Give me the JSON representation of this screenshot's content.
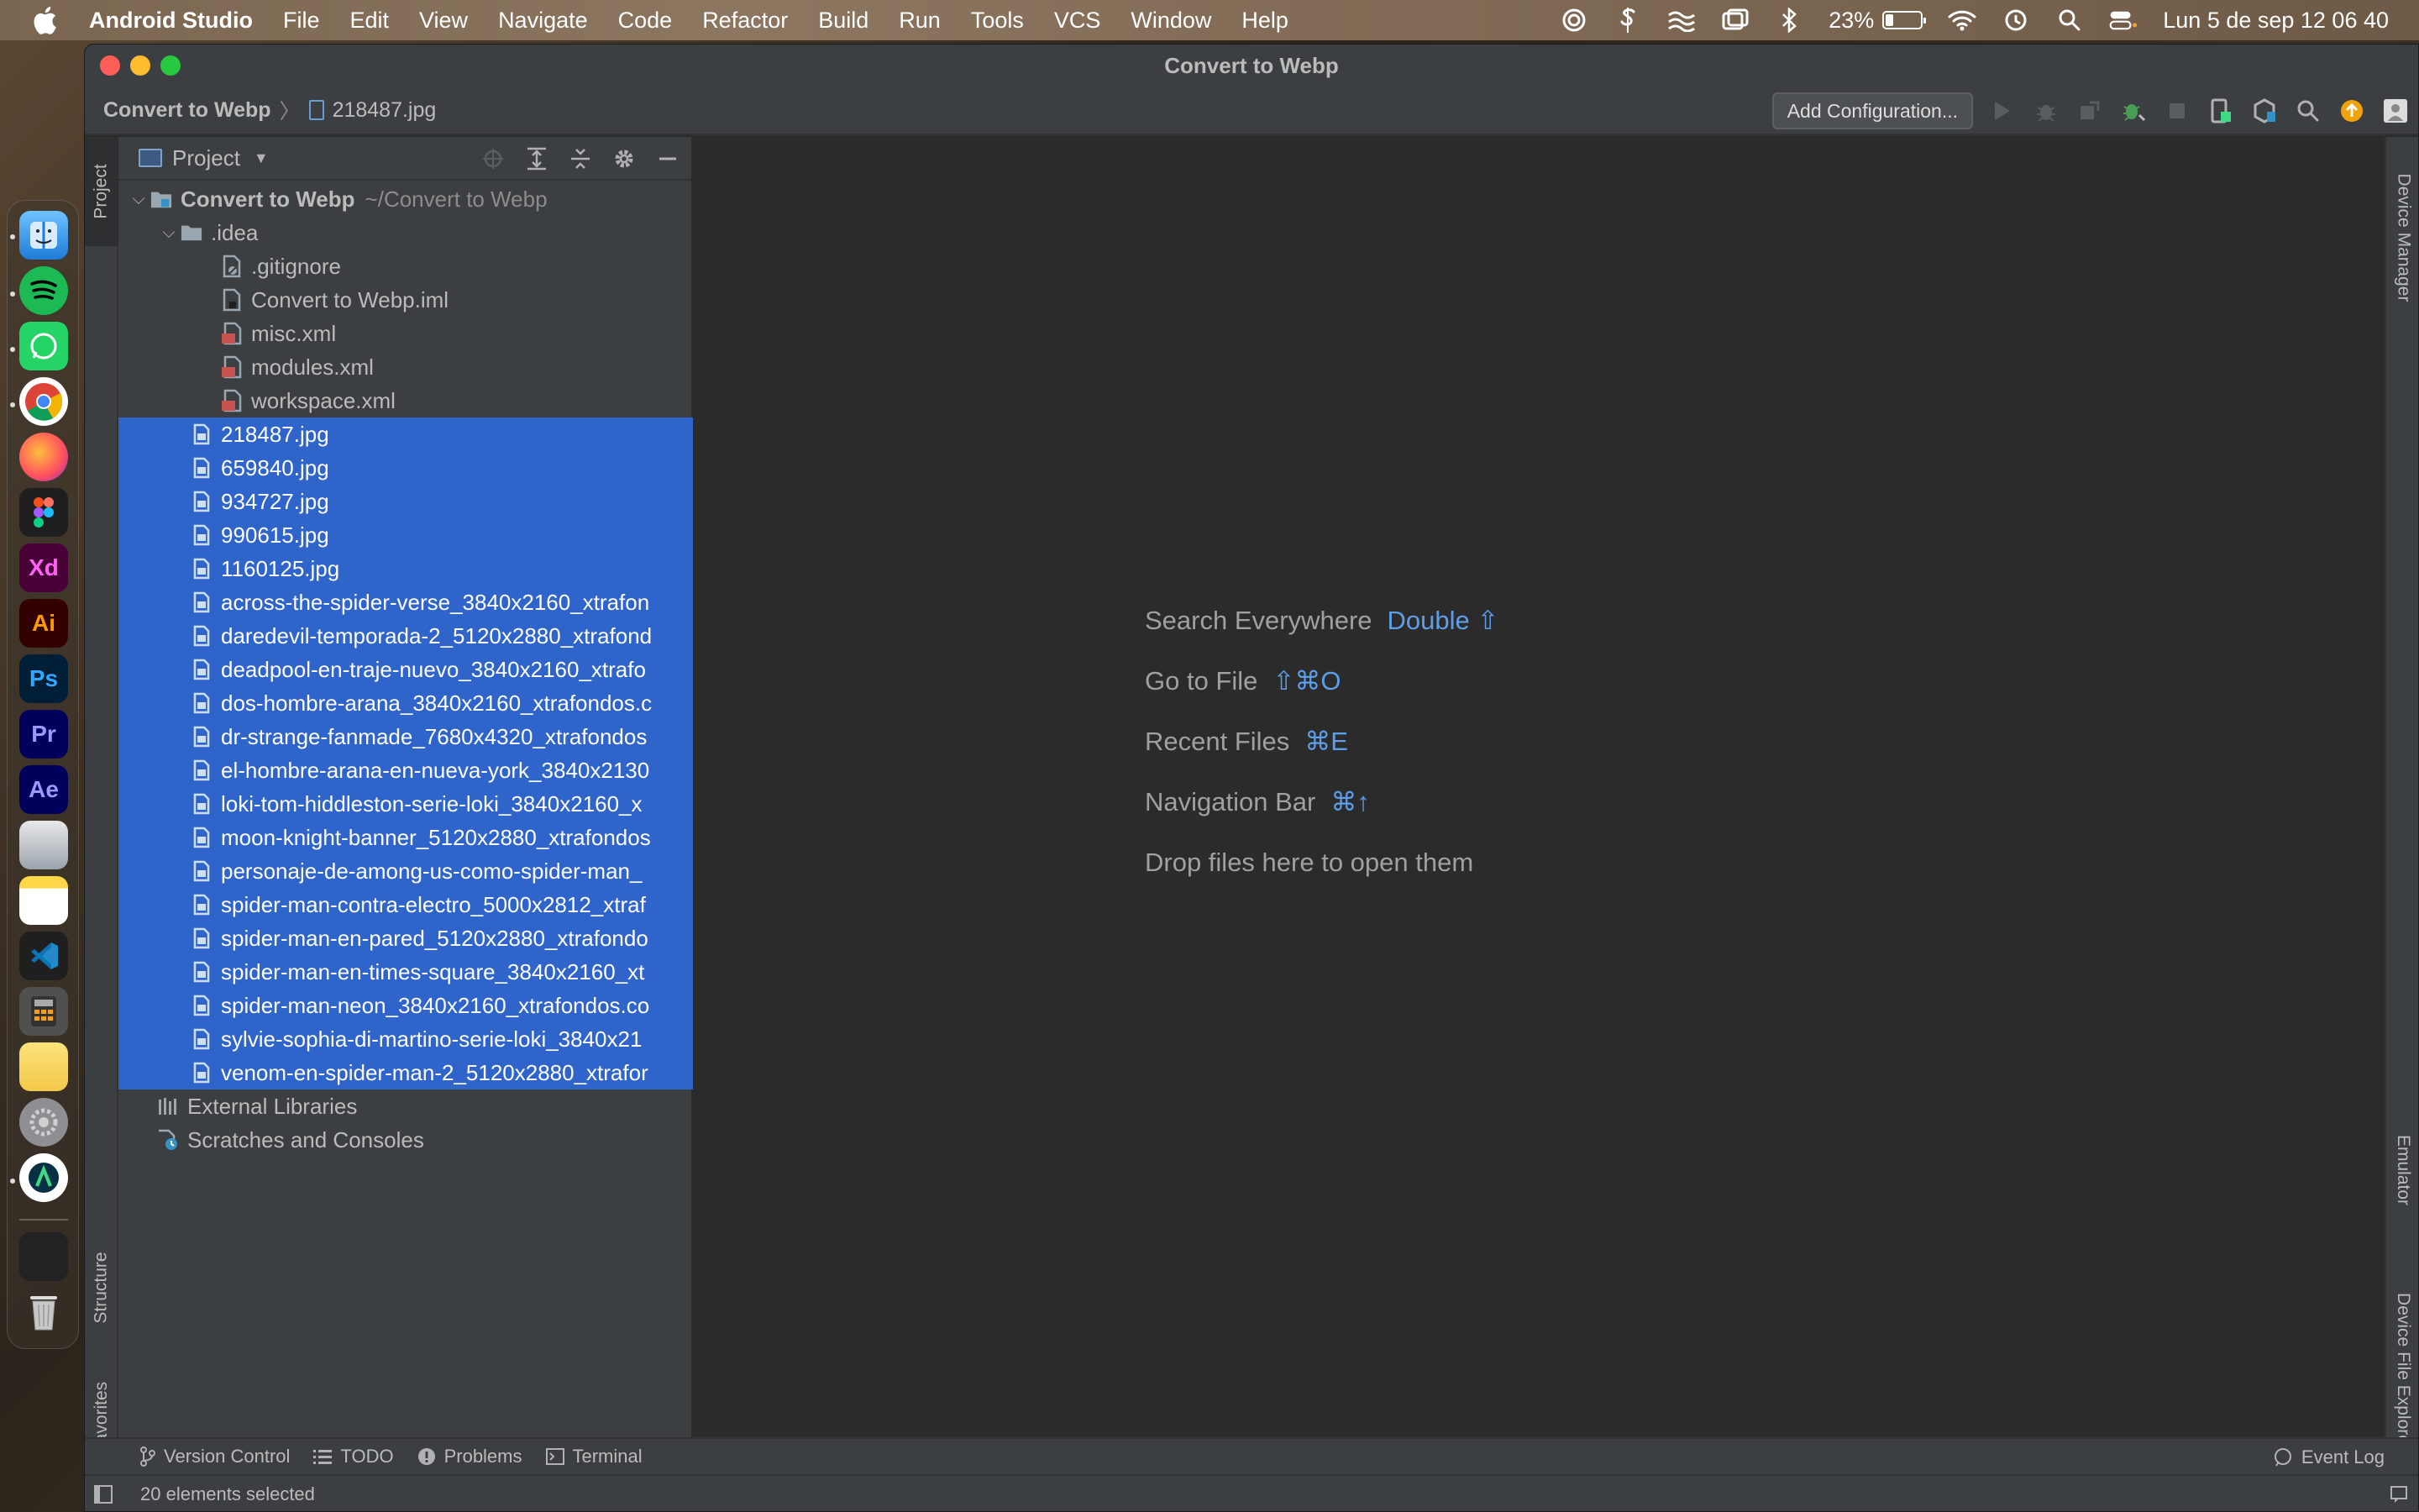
{
  "menubar": {
    "app_name": "Android Studio",
    "items": [
      "File",
      "Edit",
      "View",
      "Navigate",
      "Code",
      "Refactor",
      "Build",
      "Run",
      "Tools",
      "VCS",
      "Window",
      "Help"
    ],
    "battery_percent": "23%",
    "battery_level": 0.23,
    "datetime": "Lun 5 de sep  12 06 40"
  },
  "window": {
    "title": "Convert to Webp"
  },
  "navbar": {
    "project": "Convert to Webp",
    "file": "218487.jpg",
    "add_configuration": "Add Configuration..."
  },
  "left_tabs": {
    "project": "Project",
    "structure": "Structure",
    "favorites": "Favorites"
  },
  "right_tabs": {
    "device_manager": "Device Manager",
    "emulator": "Emulator",
    "device_file_explorer": "Device File Explorer"
  },
  "panel": {
    "title": "Project"
  },
  "tree": {
    "root_name": "Convert to Webp",
    "root_path": "~/Convert to Webp",
    "idea_folder": ".idea",
    "idea_files": [
      ".gitignore",
      "Convert to Webp.iml",
      "misc.xml",
      "modules.xml",
      "workspace.xml"
    ],
    "selected_files": [
      "218487.jpg",
      "659840.jpg",
      "934727.jpg",
      "990615.jpg",
      "1160125.jpg",
      "across-the-spider-verse_3840x2160_xtrafon",
      "daredevil-temporada-2_5120x2880_xtrafond",
      "deadpool-en-traje-nuevo_3840x2160_xtrafo",
      "dos-hombre-arana_3840x2160_xtrafondos.c",
      "dr-strange-fanmade_7680x4320_xtrafondos",
      "el-hombre-arana-en-nueva-york_3840x2130",
      "loki-tom-hiddleston-serie-loki_3840x2160_x",
      "moon-knight-banner_5120x2880_xtrafondos",
      "personaje-de-among-us-como-spider-man_",
      "spider-man-contra-electro_5000x2812_xtraf",
      "spider-man-en-pared_5120x2880_xtrafondo",
      "spider-man-en-times-square_3840x2160_xt",
      "spider-man-neon_3840x2160_xtrafondos.co",
      "sylvie-sophia-di-martino-serie-loki_3840x21",
      "venom-en-spider-man-2_5120x2880_xtrafor"
    ],
    "external_libraries": "External Libraries",
    "scratches": "Scratches and Consoles"
  },
  "editor_hints": [
    {
      "label": "Search Everywhere",
      "key": "Double ⇧"
    },
    {
      "label": "Go to File",
      "key": "⇧⌘O"
    },
    {
      "label": "Recent Files",
      "key": "⌘E"
    },
    {
      "label": "Navigation Bar",
      "key": "⌘↑"
    },
    {
      "label": "Drop files here to open them",
      "key": ""
    }
  ],
  "bottombar": {
    "version_control": "Version Control",
    "todo": "TODO",
    "problems": "Problems",
    "terminal": "Terminal",
    "event_log": "Event Log"
  },
  "status": {
    "text": "20 elements selected"
  },
  "colors": {
    "selection": "#2f65ca",
    "hint_key": "#5d9ee8",
    "panel_bg": "#3c3f41",
    "editor_bg": "#2b2b2b"
  }
}
